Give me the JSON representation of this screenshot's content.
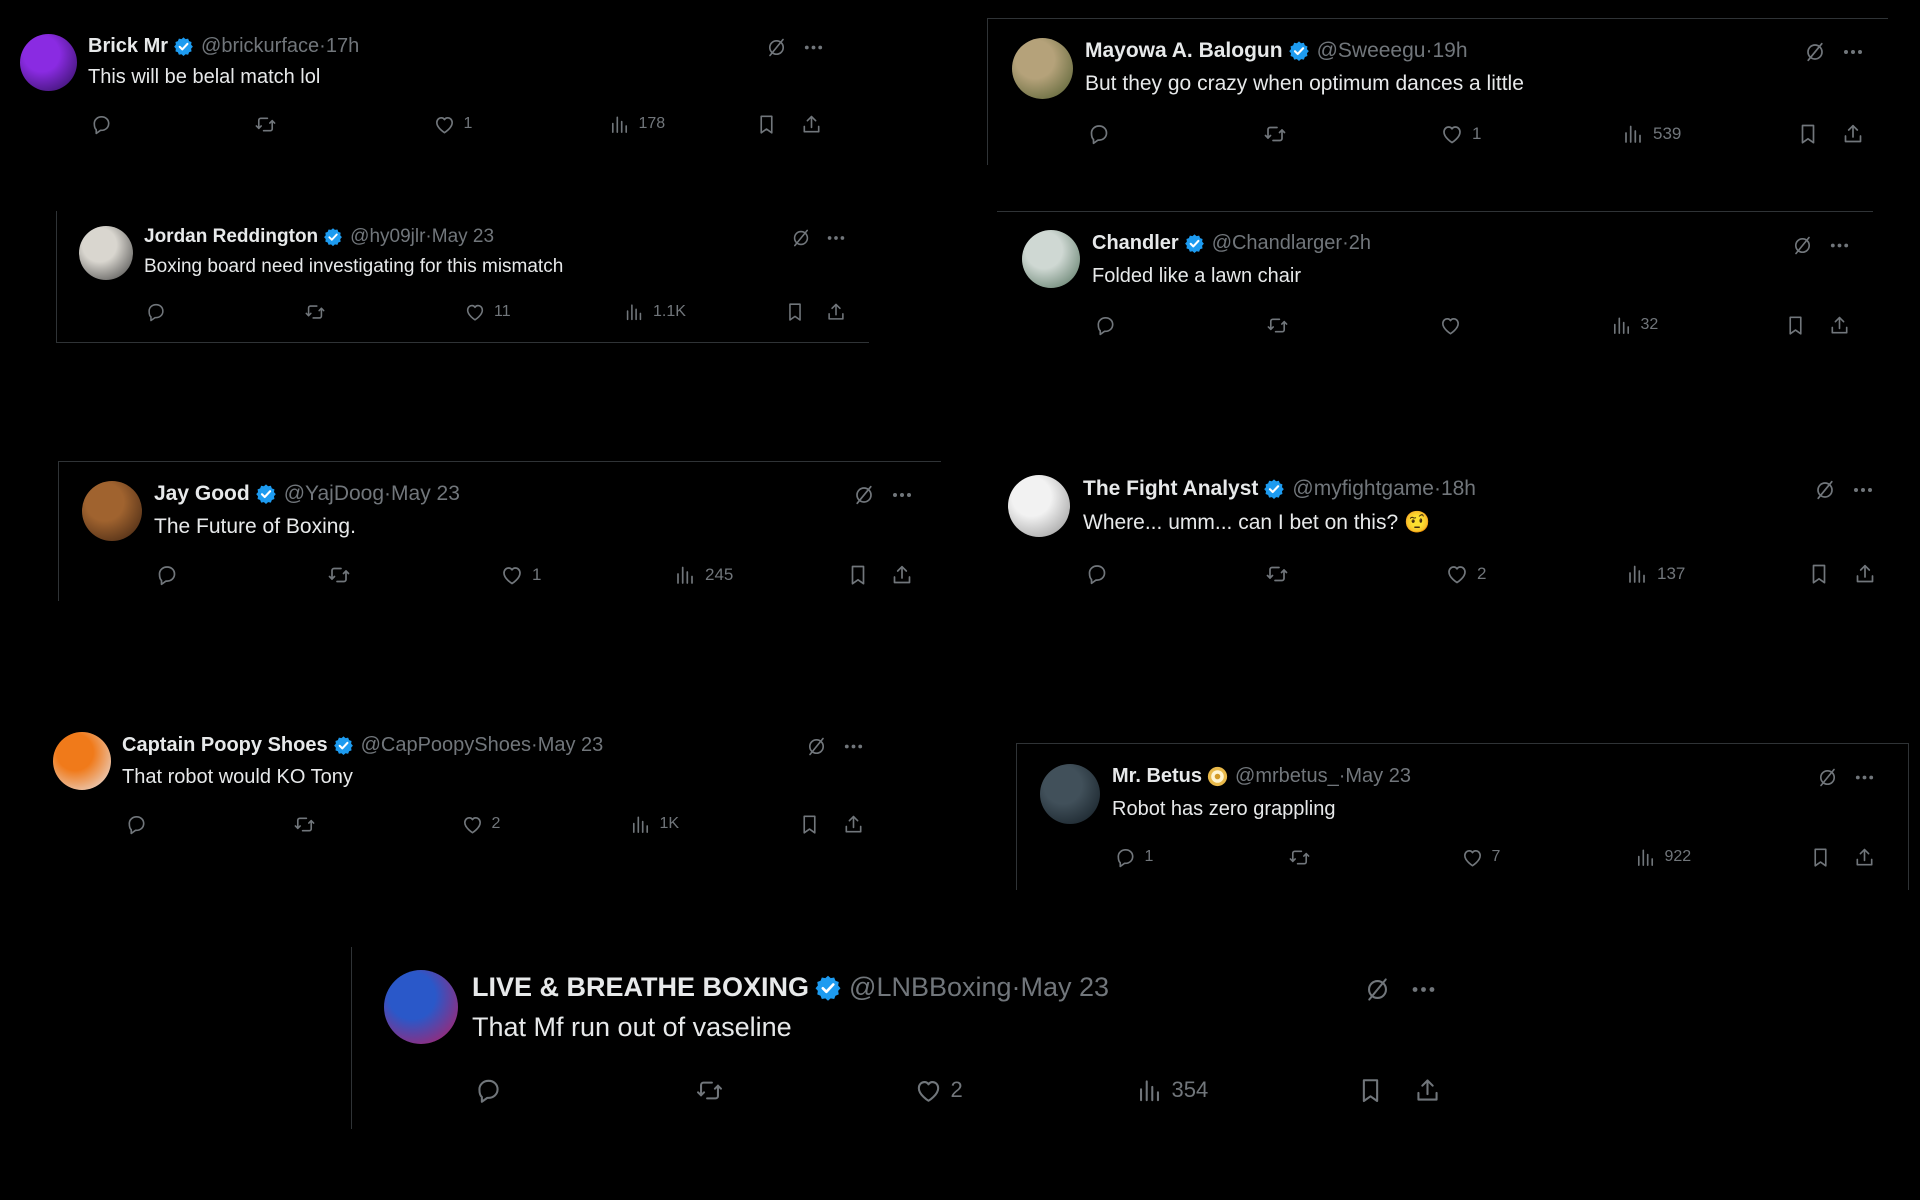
{
  "colors": {
    "background": "#000000",
    "text": "#e7e9ea",
    "muted": "#71767b",
    "verified": "#1d9bf0",
    "border": "#2f3336"
  },
  "tweets": [
    {
      "id": "brickurface",
      "name": "Brick Mr",
      "handle": "@brickurface",
      "time": "17h",
      "badge": "verified-badge-icon",
      "text": "This will be belal match lol",
      "replies": "",
      "likes": "1",
      "views": "178",
      "avatar_colors": [
        "#8a2be2",
        "#2a0f55"
      ]
    },
    {
      "id": "sweeegu",
      "name": "Mayowa A. Balogun",
      "handle": "@Sweeegu",
      "time": "19h",
      "badge": "verified-badge-icon",
      "text": "But they go crazy when optimum dances a little",
      "replies": "",
      "likes": "1",
      "views": "539",
      "avatar_colors": [
        "#b5a27a",
        "#4d5a2c"
      ]
    },
    {
      "id": "hy09jlr",
      "name": "Jordan Reddington",
      "handle": "@hy09jlr",
      "time": "May 23",
      "badge": "verified-badge-icon",
      "text": "Boxing board need investigating for this mismatch",
      "replies": "",
      "likes": "11",
      "views": "1.1K",
      "avatar_colors": [
        "#d9d6cf",
        "#3b3b3b"
      ]
    },
    {
      "id": "chandlarger",
      "name": "Chandler",
      "handle": "@Chandlarger",
      "time": "2h",
      "badge": "verified-badge-icon",
      "text": "Folded like a lawn chair",
      "replies": "",
      "likes": "",
      "views": "32",
      "avatar_colors": [
        "#cfd8d3",
        "#4f6f5a"
      ]
    },
    {
      "id": "yajdoog",
      "name": "Jay Good",
      "handle": "@YajDoog",
      "time": "May 23",
      "badge": "verified-badge-icon",
      "text": "The Future of Boxing.",
      "replies": "",
      "likes": "1",
      "views": "245",
      "avatar_colors": [
        "#a0632f",
        "#3a2010"
      ]
    },
    {
      "id": "myfightgame",
      "name": "The Fight Analyst",
      "handle": "@myfightgame",
      "time": "18h",
      "badge": "verified-badge-icon",
      "text": "Where... umm... can I bet on this? 🤨",
      "replies": "",
      "likes": "2",
      "views": "137",
      "avatar_colors": [
        "#f2f2f2",
        "#8f8f8f"
      ]
    },
    {
      "id": "cappoopyshoes",
      "name": "Captain Poopy Shoes",
      "handle": "@CapPoopyShoes",
      "time": "May 23",
      "badge": "verified-badge-icon",
      "text": "That robot would KO Tony",
      "replies": "",
      "likes": "2",
      "views": "1K",
      "avatar_colors": [
        "#f07a1a",
        "#e8e8f0"
      ]
    },
    {
      "id": "mrbetus",
      "name": "Mr. Betus",
      "handle": "@mrbetus_",
      "time": "May 23",
      "badge": "gold-coin-badge-icon",
      "text": "Robot has zero grappling",
      "replies": "1",
      "likes": "7",
      "views": "922",
      "avatar_colors": [
        "#41505a",
        "#111b22"
      ]
    },
    {
      "id": "lnbboxing",
      "name": "LIVE & BREATHE BOXING",
      "handle": "@LNBBoxing",
      "time": "May 23",
      "badge": "verified-badge-icon",
      "text": "That Mf run out of vaseline",
      "replies": "",
      "likes": "2",
      "views": "354",
      "avatar_colors": [
        "#2a58c9",
        "#c2185b"
      ]
    }
  ],
  "icons": {
    "reply": "reply-icon",
    "retweet": "retweet-icon",
    "like": "heart-icon",
    "views": "views-chart-icon",
    "bookmark": "bookmark-icon",
    "share": "share-icon",
    "grok": "grok-icon",
    "more": "more-icon"
  }
}
